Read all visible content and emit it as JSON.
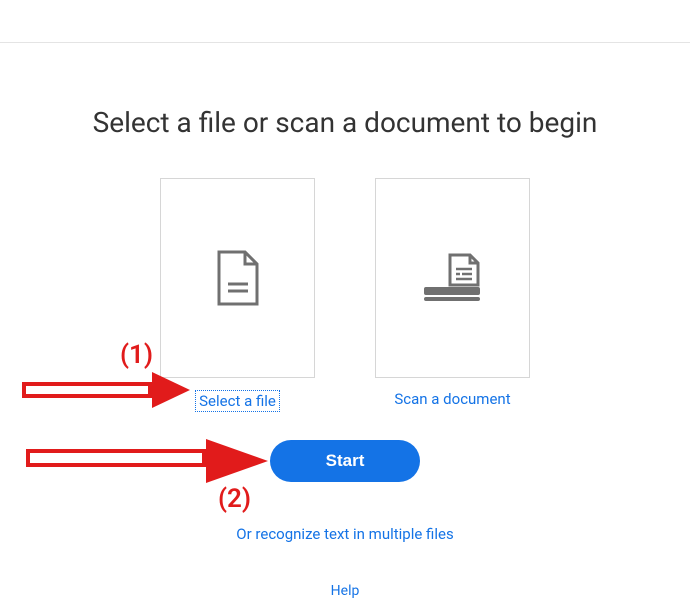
{
  "title": "Select a file or scan a document to begin",
  "cards": {
    "select_file": {
      "label": "Select a file"
    },
    "scan_document": {
      "label": "Scan a document"
    }
  },
  "start_button": "Start",
  "alt_link": "Or recognize text in multiple files",
  "help_link": "Help",
  "annotations": {
    "arrow1_label": "(1)",
    "arrow2_label": "(2)"
  },
  "colors": {
    "accent": "#1473e6",
    "annotation": "#e11b1b"
  }
}
